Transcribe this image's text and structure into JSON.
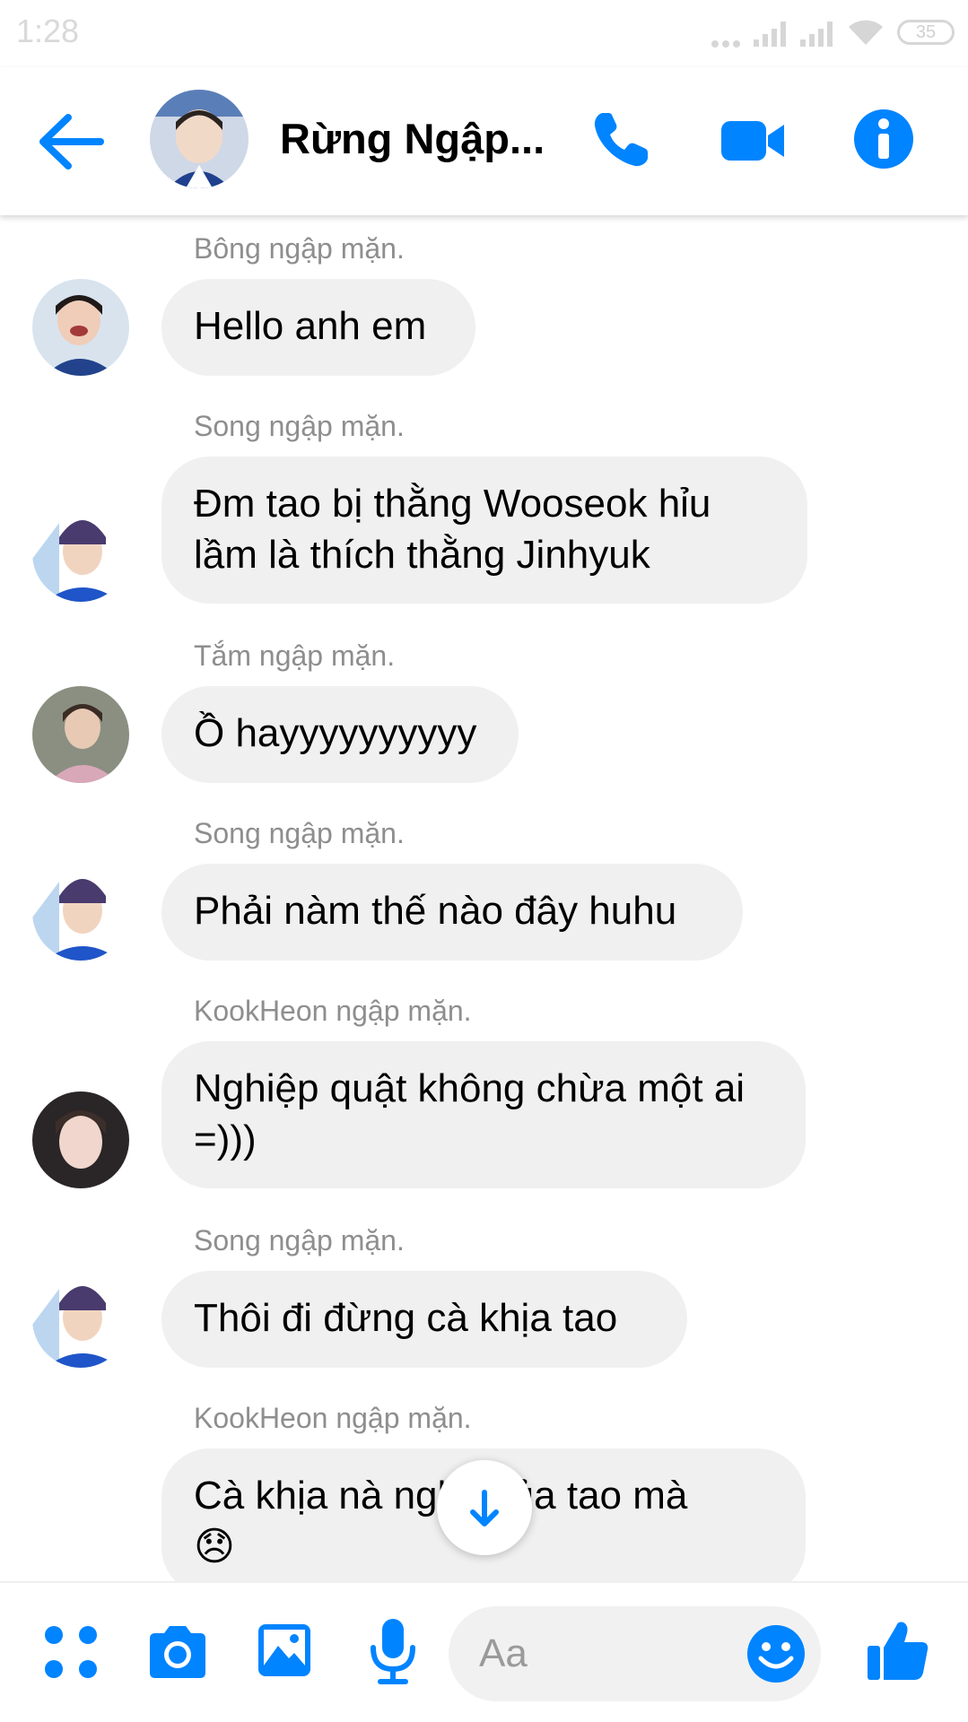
{
  "status_bar": {
    "time": "1:28",
    "battery": "35"
  },
  "header": {
    "title": "Rừng Ngập..."
  },
  "messages": [
    {
      "sender": "Bông ngập mặn.",
      "text": "Hello anh em"
    },
    {
      "sender": "Song ngập mặn.",
      "text": "Đm tao bị thằng Wooseok hỉu lầm là thích thằng Jinhyuk"
    },
    {
      "sender": "Tắm ngập mặn.",
      "text": "Ồ hayyyyyyyyyy"
    },
    {
      "sender": "Song ngập mặn.",
      "text": "Phải nàm thế nào đây huhu"
    },
    {
      "sender": "KookHeon ngập mặn.",
      "text": "Nghiệp quật không chừa một ai =)))"
    },
    {
      "sender": "Song ngập mặn.",
      "text": "Thôi đi đừng cà khịa tao"
    },
    {
      "sender": "KookHeon ngập mặn.",
      "text": "Cà khịa nà nghề của tao mà",
      "emoji": "😞"
    }
  ],
  "composer": {
    "placeholder": "Aa"
  },
  "icons": {
    "back": "arrow-left-icon",
    "call": "phone-icon",
    "video": "video-camera-icon",
    "info": "info-icon",
    "menu": "four-dots-icon",
    "camera": "camera-icon",
    "gallery": "image-icon",
    "mic": "microphone-icon",
    "emoji": "smiley-icon",
    "like": "thumbs-up-icon",
    "scroll": "arrow-down-icon"
  },
  "colors": {
    "accent": "#0084ff",
    "bubble": "#f0f0f0",
    "sender_text": "#8e8e8e"
  }
}
